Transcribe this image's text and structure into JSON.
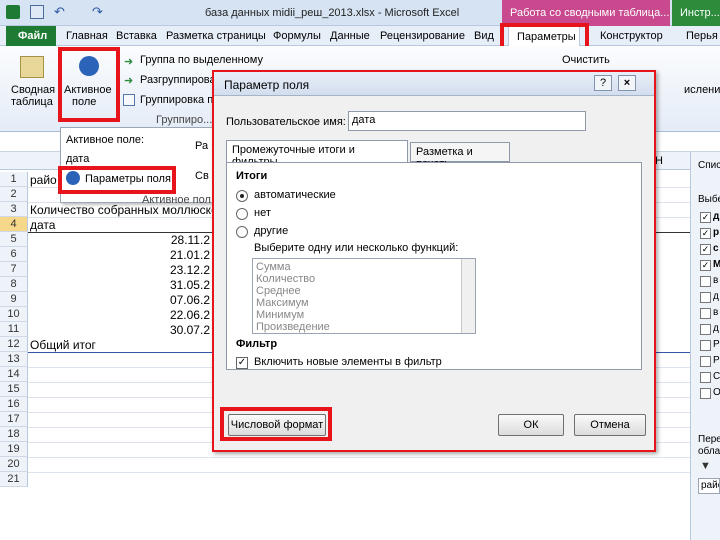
{
  "window": {
    "title": "база данных midii_реш_2013.xlsx - Microsoft Excel",
    "context_tab_pivot": "Работа со сводными таблица...",
    "context_tab_other": "Инстр..."
  },
  "menu": {
    "file": "Файл",
    "items": [
      "Главная",
      "Вставка",
      "Разметка страницы",
      "Формулы",
      "Данные",
      "Рецензирование",
      "Вид"
    ],
    "params": "Параметры",
    "constructor": "Конструктор",
    "cut": "Перья"
  },
  "ribbon": {
    "pivot_line1": "Сводная",
    "pivot_line2": "таблица",
    "active_field_line1": "Активное",
    "active_field_line2": "поле",
    "group_selection": "Группа по выделенному",
    "ungroup": "Разгруппировать",
    "group_field": "Группировка по полю",
    "group_label": "Группиро...",
    "clear": "Очистить",
    "calc": "исления"
  },
  "popup": {
    "active_field_label": "Активное поле:",
    "field_value": "дата",
    "field_settings": "Параметры поля",
    "frag1": "Ра",
    "frag2": "Св",
    "frag3": "Активное пол"
  },
  "sheet": {
    "col_h": "H",
    "rows": [
      "1",
      "2",
      "3",
      "4",
      "5",
      "6",
      "7",
      "8",
      "9",
      "10",
      "11",
      "12",
      "13",
      "14",
      "15",
      "16",
      "17",
      "18",
      "19",
      "20",
      "21"
    ],
    "cells": {
      "r1": "райо",
      "r3": "Количество собранных моллюсков",
      "r4": "дата",
      "r12": "Общий итог"
    },
    "dates": [
      "28.11.2",
      "21.01.2",
      "23.12.2",
      "31.05.2",
      "07.06.2",
      "22.06.2",
      "30.07.2"
    ]
  },
  "dialog": {
    "title": "Параметр поля",
    "help": "?",
    "close": "×",
    "custom_name_label": "Пользовательское имя:",
    "custom_name_value": "дата",
    "tab_subtotals": "Промежуточные итоги и фильтры",
    "tab_layout": "Разметка и печать",
    "section_totals": "Итоги",
    "radio_auto": "автоматические",
    "radio_none": "нет",
    "radio_other": "другие",
    "choose_funcs": "Выберите одну или несколько функций:",
    "functions": [
      "Сумма",
      "Количество",
      "Среднее",
      "Максимум",
      "Минимум",
      "Произведение"
    ],
    "section_filter": "Фильтр",
    "include_new": "Включить новые элементы в фильтр",
    "number_format": "Числовой формат",
    "ok": "ОК",
    "cancel": "Отмена"
  },
  "right_pane": {
    "top": "Спис",
    "choose": "Выбе",
    "fields": [
      "д",
      "р",
      "с",
      "М",
      "в",
      "д",
      "в",
      "д",
      "Р",
      "Р",
      "С",
      "О"
    ],
    "checked": [
      true,
      true,
      true,
      true,
      false,
      false,
      false,
      false,
      false,
      false,
      false,
      false
    ],
    "drag": "Пере",
    "area": "обла",
    "row_item": "райо"
  },
  "colors": {
    "highlight": "#e8141c",
    "pivot_tab": "#c8498e",
    "file_tab": "#1e7b34"
  }
}
